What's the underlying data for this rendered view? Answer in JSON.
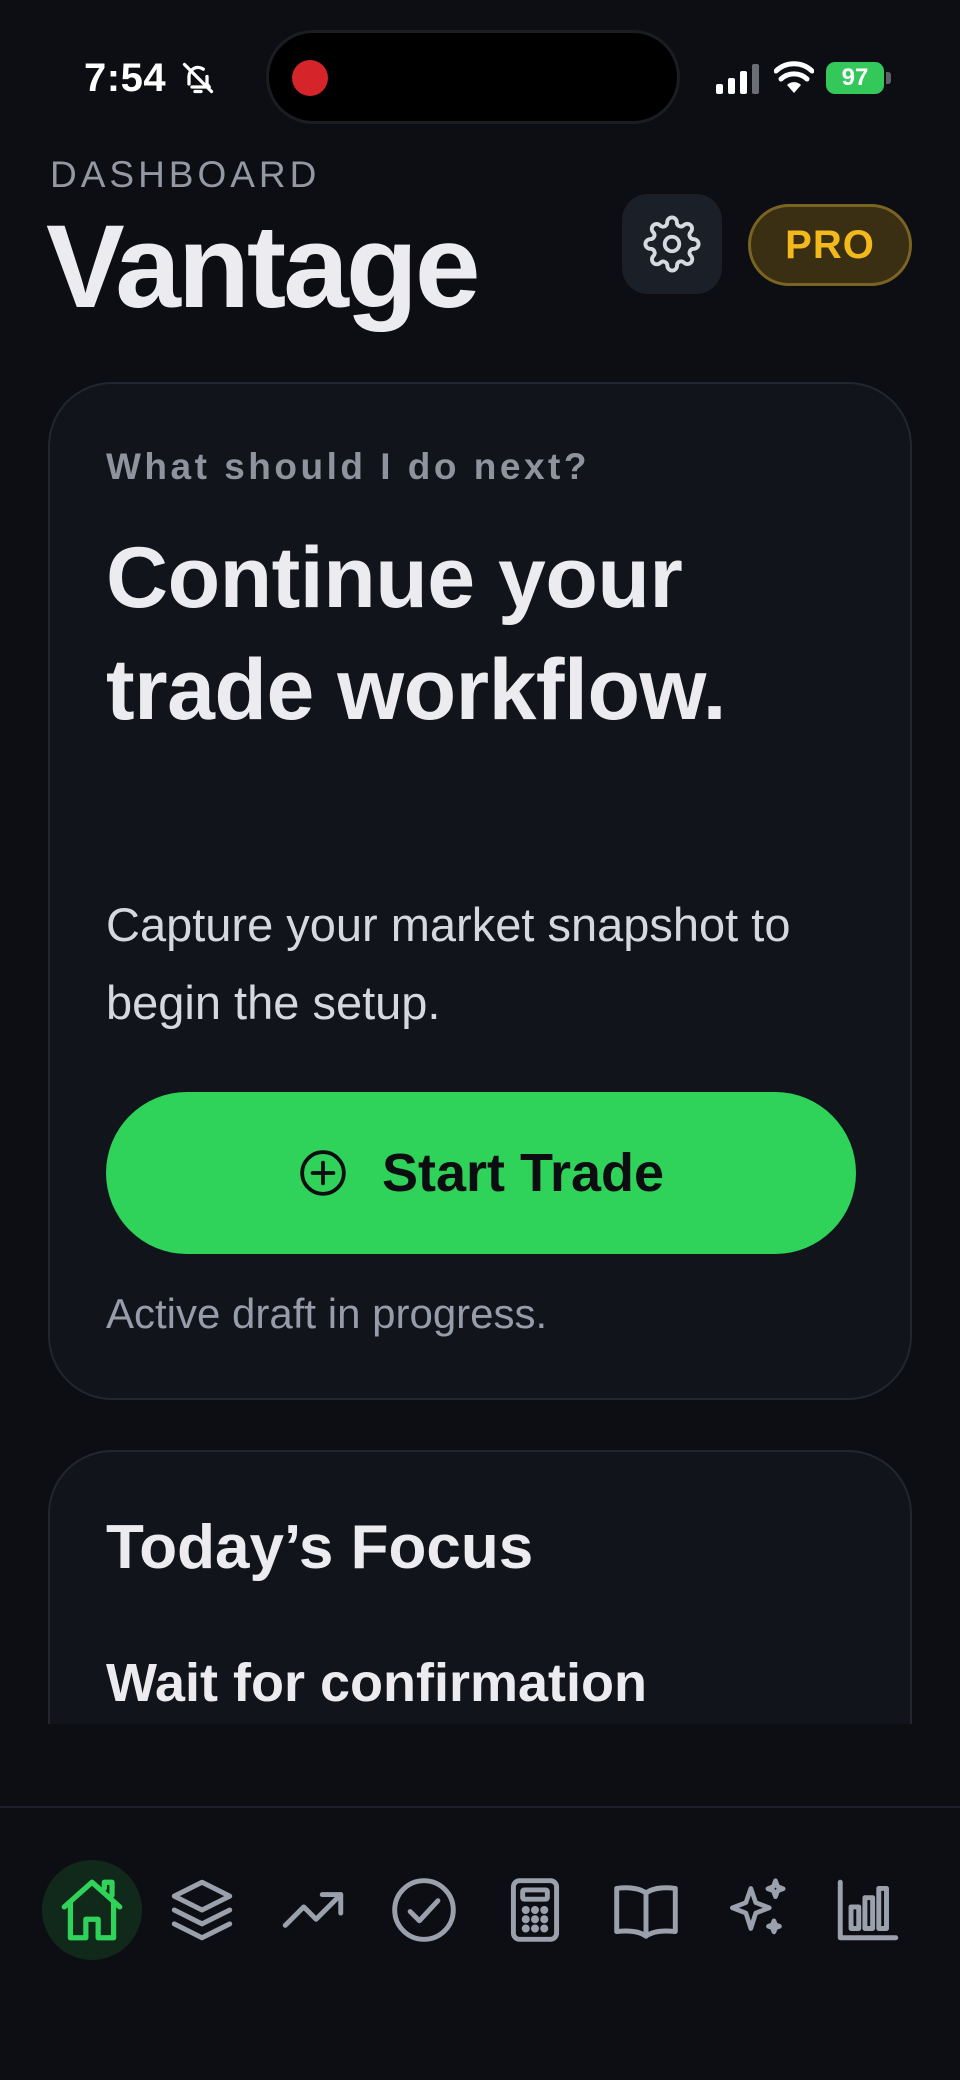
{
  "status_bar": {
    "time": "7:54",
    "battery": "97"
  },
  "header": {
    "eyebrow": "DASHBOARD",
    "title": "Vantage",
    "badge": "PRO"
  },
  "next_card": {
    "label": "What should I do next?",
    "heading": "Continue your trade workflow.",
    "description": "Capture your market snapshot to begin the setup.",
    "button_label": "Start Trade",
    "note": "Active draft in progress."
  },
  "focus_card": {
    "title": "Today’s Focus",
    "item": "Wait for confirmation"
  },
  "tab_bar": {
    "tabs": [
      {
        "icon": "home-icon",
        "active": true
      },
      {
        "icon": "layers-icon",
        "active": false
      },
      {
        "icon": "trend-up-icon",
        "active": false
      },
      {
        "icon": "check-circle-icon",
        "active": false
      },
      {
        "icon": "calculator-icon",
        "active": false
      },
      {
        "icon": "book-icon",
        "active": false
      },
      {
        "icon": "sparkles-icon",
        "active": false
      },
      {
        "icon": "bar-chart-icon",
        "active": false
      }
    ]
  },
  "colors": {
    "background": "#0c0e13",
    "card": "#11141a",
    "accent_green": "#2fd35a",
    "pro_gold": "#f3b81b",
    "muted_text": "#979cab",
    "icon_gray": "#9aa0ac"
  }
}
